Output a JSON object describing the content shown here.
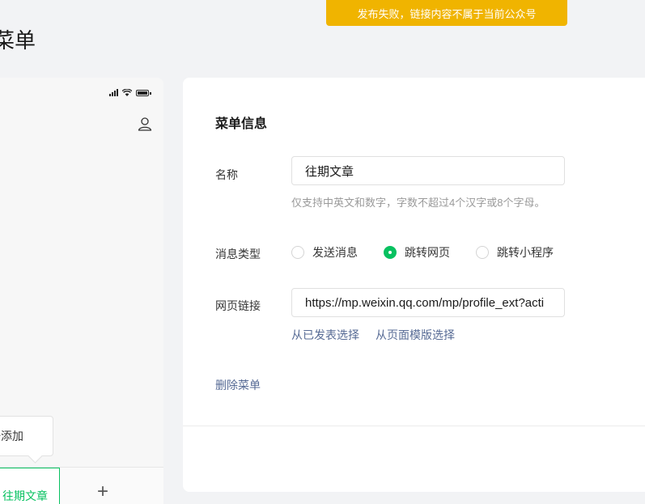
{
  "toast": {
    "text": "发布失败，链接内容不属于当前公众号"
  },
  "page": {
    "title": "菜单"
  },
  "phone": {
    "popup_add_label": "添加",
    "menu_items": [
      "往期文章"
    ],
    "add_symbol": "+"
  },
  "menu_info": {
    "title": "菜单信息",
    "name_label": "名称",
    "name_value": "往期文章",
    "name_hint": "仅支持中英文和数字，字数不超过4个汉字或8个字母。",
    "type_label": "消息类型",
    "type_options": [
      "发送消息",
      "跳转网页",
      "跳转小程序"
    ],
    "type_selected": "跳转网页",
    "url_label": "网页链接",
    "url_value": "https://mp.weixin.qq.com/mp/profile_ext?acti",
    "select_published": "从已发表选择",
    "select_template": "从页面模版选择",
    "delete_label": "删除菜单"
  },
  "colors": {
    "accent": "#07c160",
    "warning": "#f0b400",
    "link": "#576b95"
  }
}
